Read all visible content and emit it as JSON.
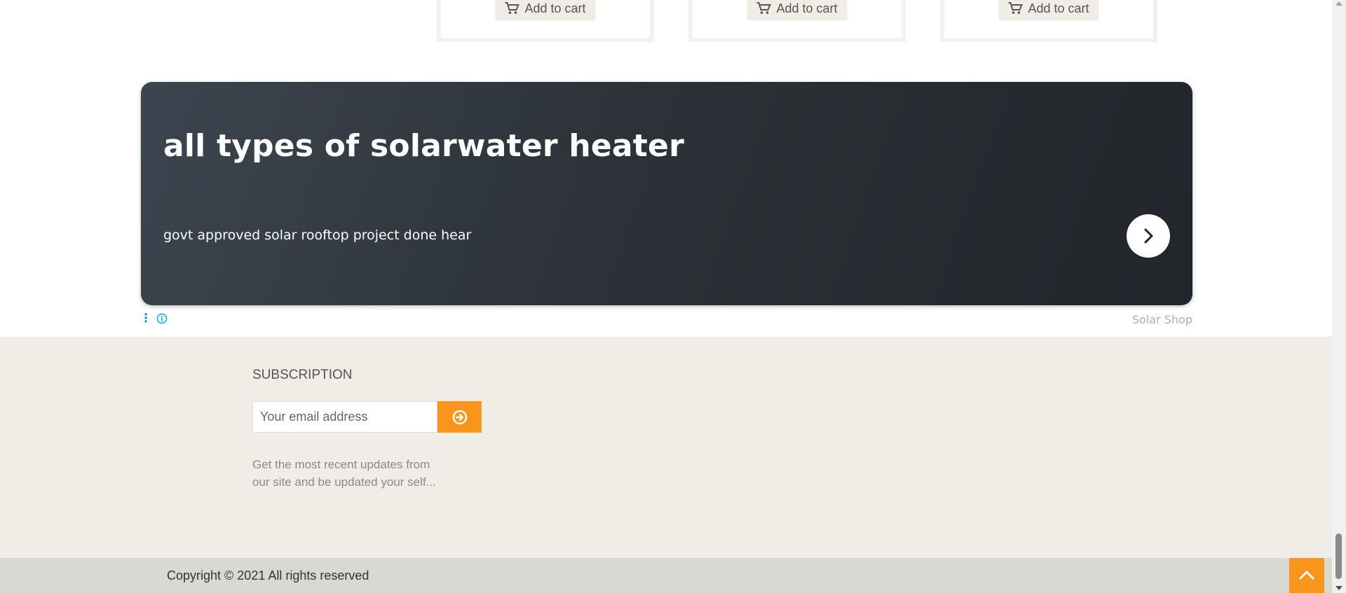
{
  "products": {
    "cart_label": "Add to cart"
  },
  "ad": {
    "headline": "all types of solarwater heater",
    "subtext": "govt approved solar rooftop project done hear",
    "label": "Solar Shop"
  },
  "subscription": {
    "title": "SUBSCRIPTION",
    "email_placeholder": "Your email address",
    "description_line1": "Get the most recent updates from",
    "description_line2": "our site and be updated your self..."
  },
  "footer": {
    "copyright": "Copyright © 2021 All rights reserved"
  },
  "colors": {
    "accent": "#f7951d",
    "section_bg": "#efede6",
    "footer_bg": "#d9d9d3"
  },
  "icons": {
    "cart": "cart-icon",
    "next": "chevron-right-icon",
    "submit": "circle-arrow-right-icon",
    "back_to_top": "chevron-up-icon",
    "ad_info": "info-icon",
    "ad_options": "more-vertical-icon"
  }
}
